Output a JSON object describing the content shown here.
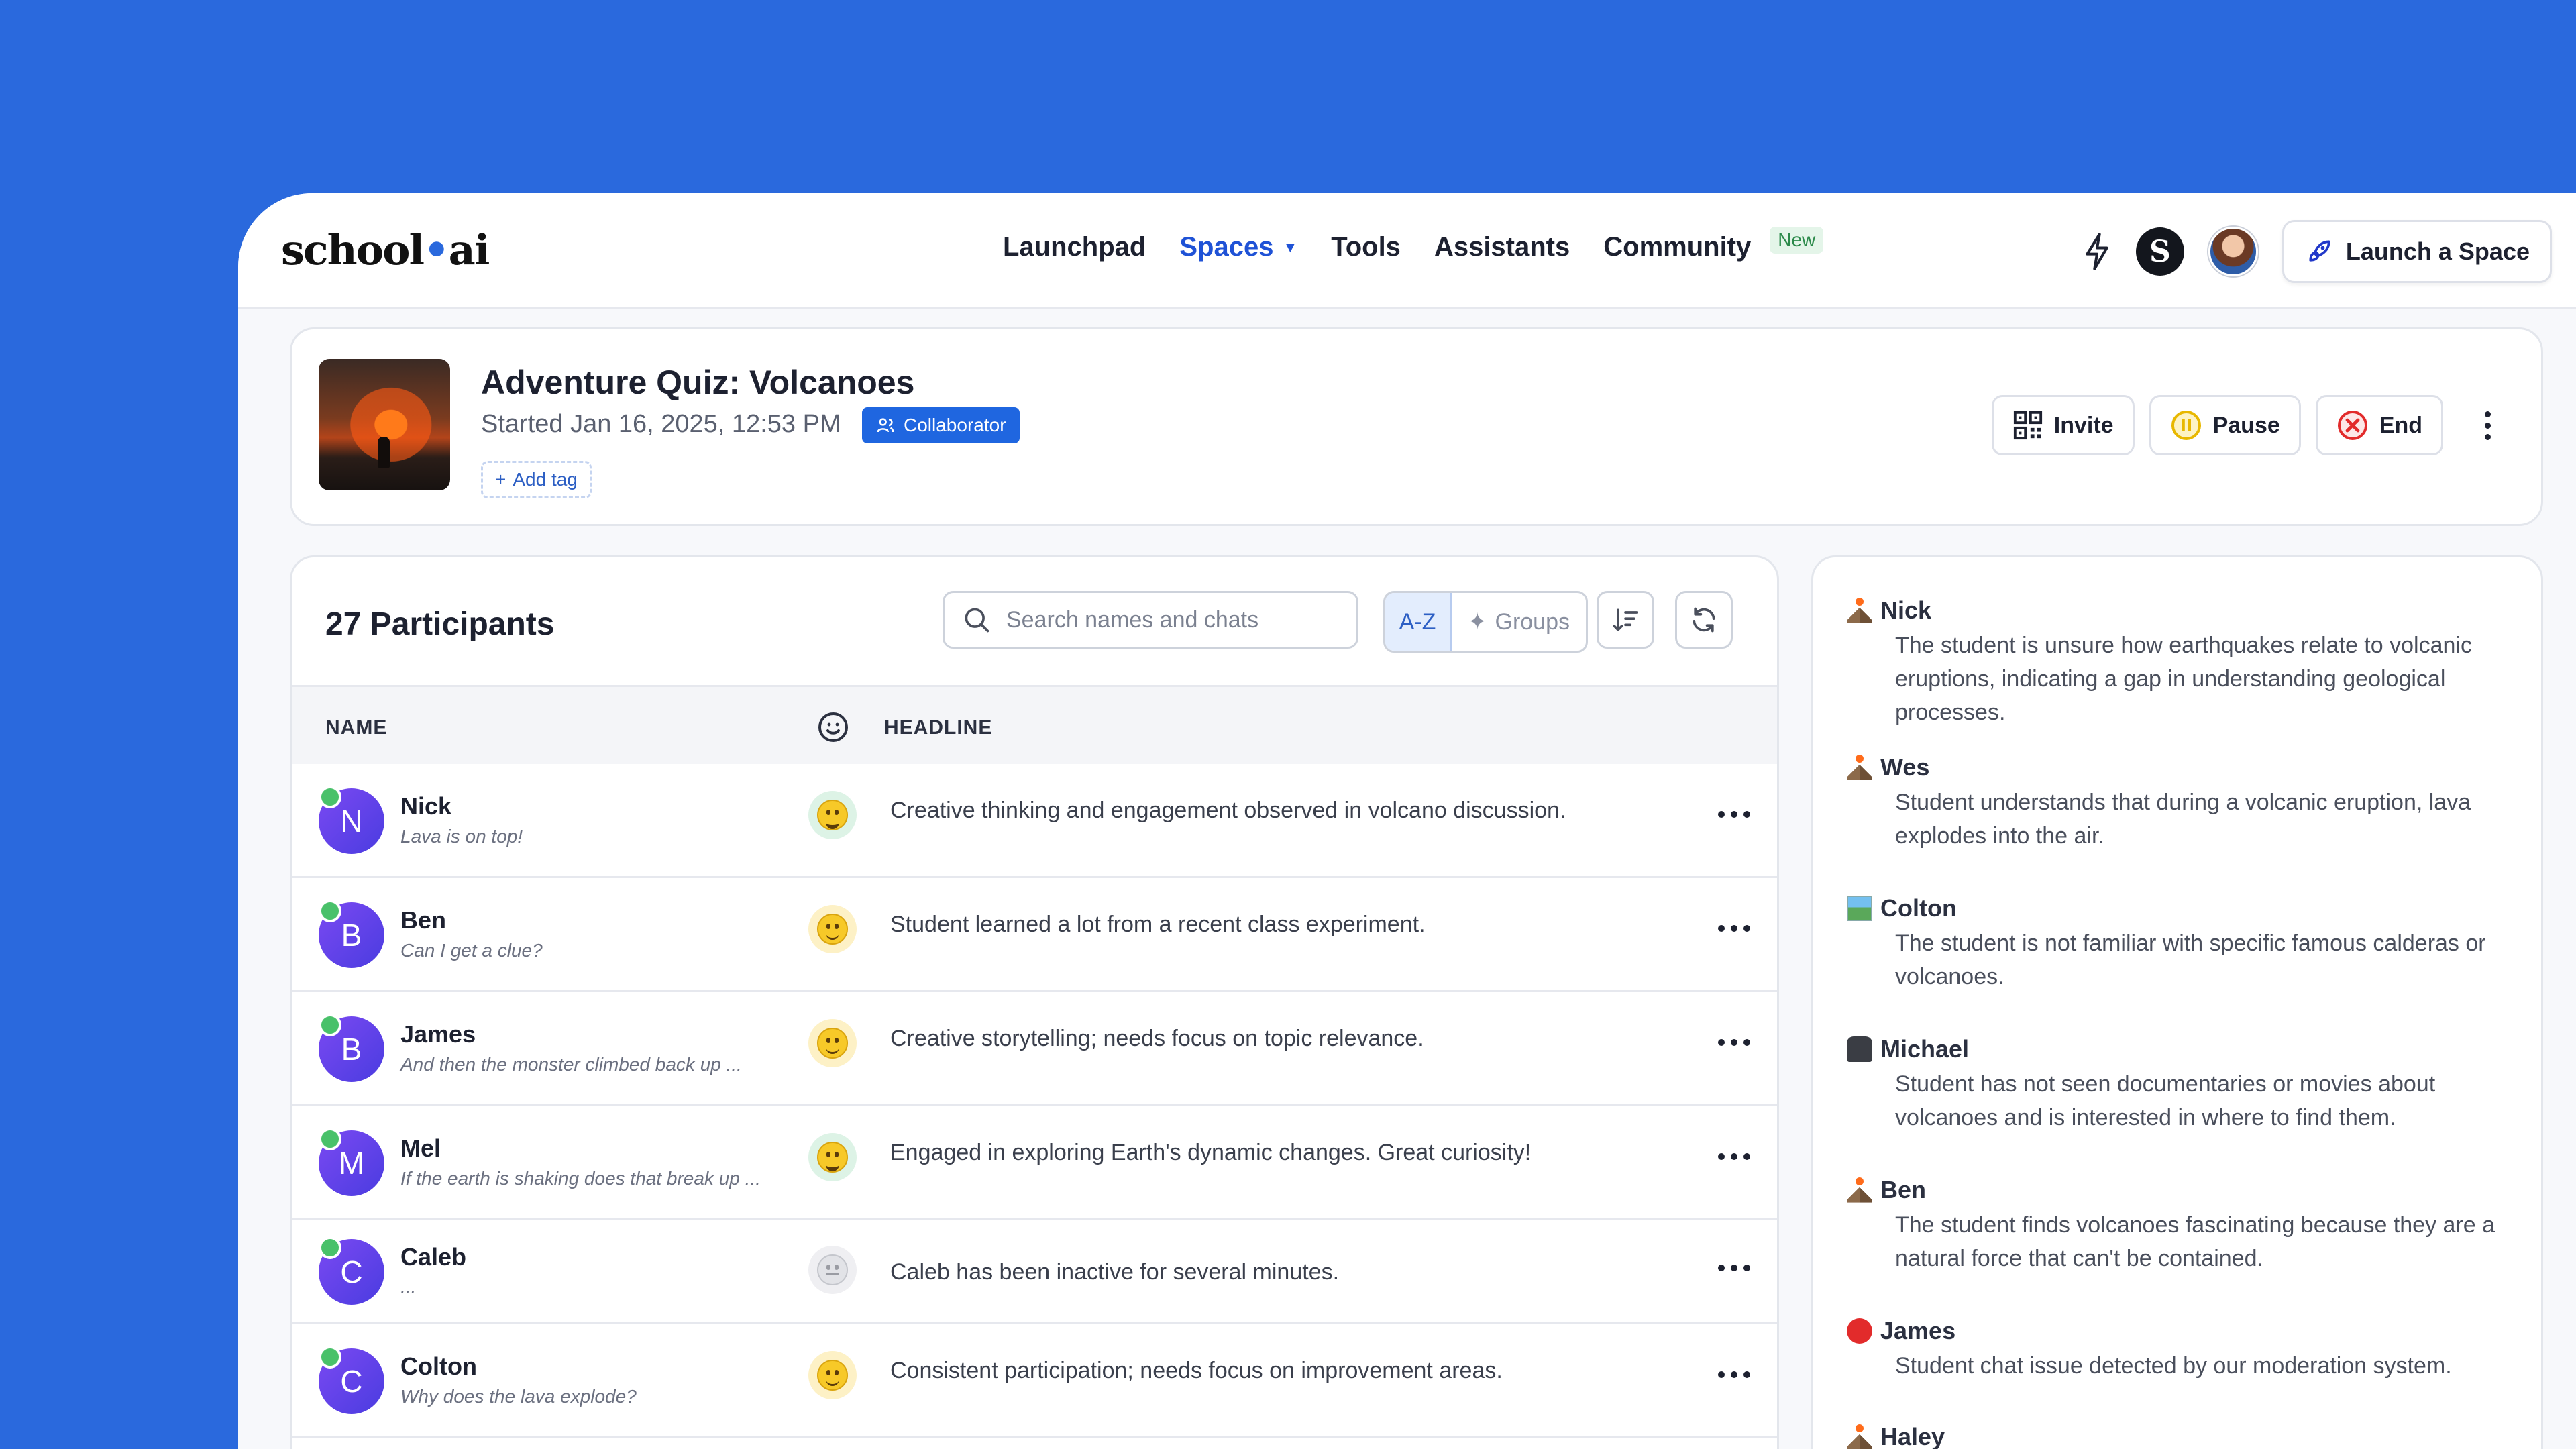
{
  "nav": {
    "logo": "school",
    "logo_suffix": "ai",
    "items": [
      {
        "label": "Launchpad"
      },
      {
        "label": "Spaces"
      },
      {
        "label": "Tools"
      },
      {
        "label": "Assistants"
      },
      {
        "label": "Community"
      }
    ],
    "new_badge": "New",
    "launch_label": "Launch a Space",
    "profile_initial": "S"
  },
  "space": {
    "title": "Adventure Quiz: Volcanoes",
    "started": "Started Jan 16, 2025, 12:53 PM",
    "role_badge": "Collaborator",
    "add_tag": "Add tag",
    "invite_label": "Invite",
    "pause_label": "Pause",
    "end_label": "End"
  },
  "participants": {
    "title": "27 Participants",
    "search_placeholder": "Search names and chats",
    "sort_az": "A-Z",
    "sort_groups": "Groups",
    "col_name": "NAME",
    "col_headline": "HEADLINE",
    "rows": [
      {
        "initial": "N",
        "name": "Nick",
        "message": "Lava is on top!",
        "mood": "happy",
        "headline": "Creative thinking and engagement observed in volcano discussion."
      },
      {
        "initial": "B",
        "name": "Ben",
        "message": "Can I get a clue?",
        "mood": "smile",
        "headline": "Student learned a lot from a recent class experiment."
      },
      {
        "initial": "B",
        "name": "James",
        "message": "And then the monster climbed back up ...",
        "mood": "smile",
        "headline": "Creative storytelling; needs focus on topic relevance."
      },
      {
        "initial": "M",
        "name": "Mel",
        "message": "If the earth is shaking does that break up ...",
        "mood": "happy",
        "headline": "Engaged in exploring Earth's dynamic changes. Great curiosity!"
      },
      {
        "initial": "C",
        "name": "Caleb",
        "message": "...",
        "mood": "idle",
        "headline": "Caleb has been inactive for several minutes."
      },
      {
        "initial": "C",
        "name": "Colton",
        "message": "Why does the lava explode?",
        "mood": "smile",
        "headline": "Consistent participation; needs focus on improvement areas."
      }
    ]
  },
  "summary": [
    {
      "icon": "volcano-icon",
      "name": "Nick",
      "text": "The student is unsure how earthquakes relate to volcanic eruptions, indicating a gap in understanding geological processes."
    },
    {
      "icon": "volcano-icon",
      "name": "Wes",
      "text": "Student understands that during a volcanic eruption, lava explodes into the air."
    },
    {
      "icon": "map-icon",
      "name": "Colton",
      "text": "The student is not familiar with specific famous calderas or volcanoes."
    },
    {
      "icon": "camera-icon",
      "name": "Michael",
      "text": "Student has not seen documentaries or movies about volcanoes and is interested in where to find them."
    },
    {
      "icon": "volcano-icon",
      "name": "Ben",
      "text": "The student finds volcanoes fascinating because they are a natural force that can't be contained."
    },
    {
      "icon": "redcircle-icon",
      "name": "James",
      "text": "Student chat issue detected by our moderation system."
    },
    {
      "icon": "volcano-icon",
      "name": "Haley",
      "text": ""
    }
  ]
}
